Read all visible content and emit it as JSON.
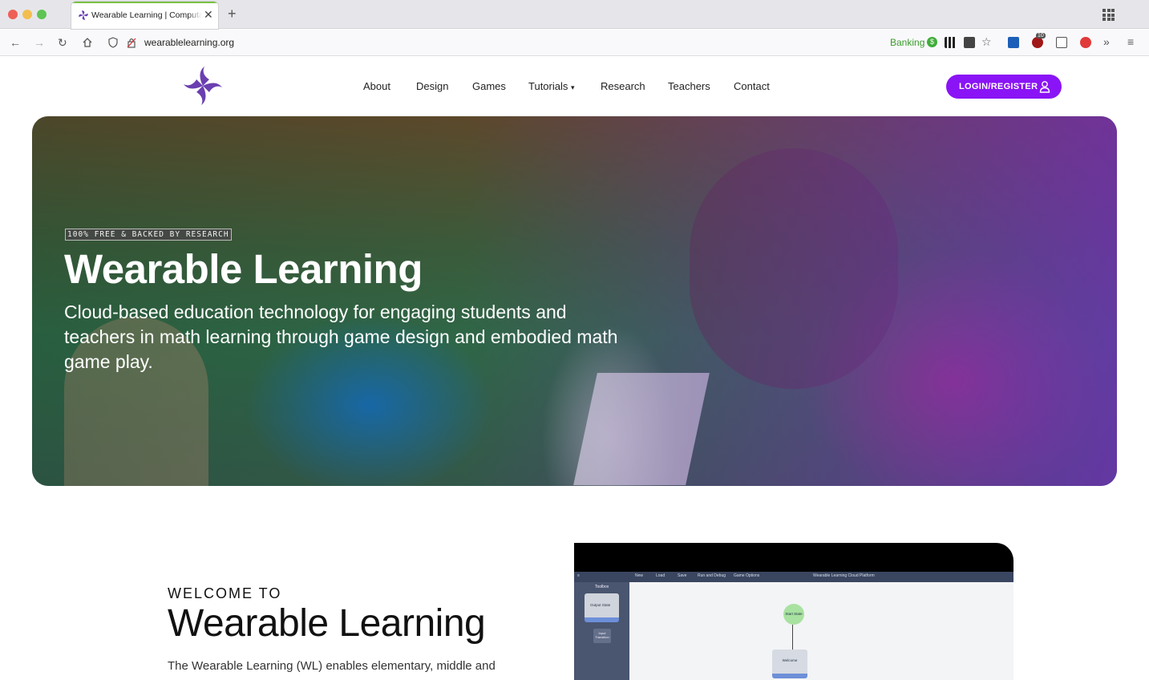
{
  "browser": {
    "tab_title": "Wearable Learning | Computational Thinking",
    "url": "wearablelearning.org",
    "banking_label": "Banking",
    "banking_badge": "$",
    "extension_badge_count": "10"
  },
  "site": {
    "nav": {
      "items": [
        "About",
        "Design",
        "Games",
        "Tutorials",
        "Research",
        "Teachers",
        "Contact"
      ],
      "login_label": "LOGIN/REGISTER"
    },
    "hero": {
      "badge": "100% FREE & BACKED BY RESEARCH",
      "title": "Wearable Learning",
      "subtitle": "Cloud-based education technology for engaging students and teachers in math learning through game design and embodied math game play."
    },
    "welcome": {
      "kicker": "WELCOME TO",
      "title": "Wearable Learning",
      "body": "The Wearable Learning (WL) enables elementary, middle and"
    },
    "preview": {
      "menu": [
        "New",
        "Load",
        "Save",
        "Run and Debug",
        "Game Options"
      ],
      "app_title": "Wearable Learning Cloud Platform",
      "toolbox_label": "Toolbox",
      "toolbox_output_state": "Output State",
      "toolbox_input_transition": "Input Transition",
      "node_start": "Start State",
      "node_welcome": "Welcome"
    }
  },
  "colors": {
    "brand_purple": "#8a14f5",
    "logo_purple": "#6a3fb0",
    "tab_accent": "#7ac143"
  }
}
